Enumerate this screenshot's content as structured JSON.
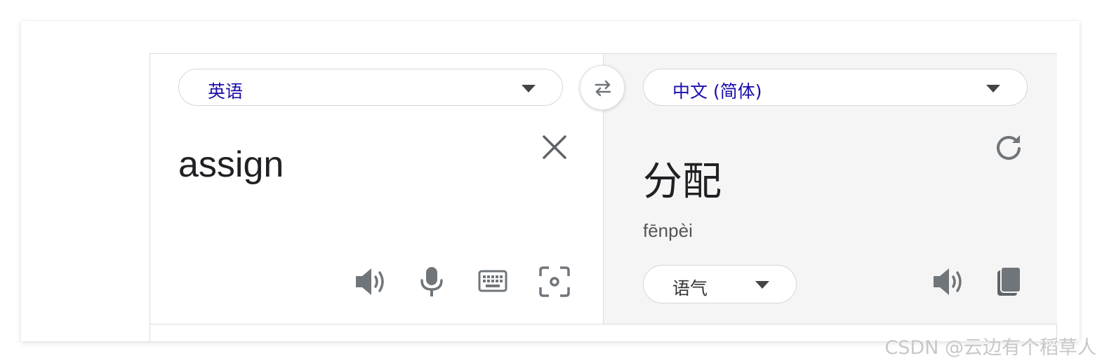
{
  "source": {
    "language": "英语",
    "text": "assign"
  },
  "target": {
    "language": "中文 (简体)",
    "text": "分配",
    "pinyin": "fēnpèi",
    "tone": "语气"
  },
  "icons": {
    "swap": "swap-arrows-icon",
    "clear": "close-icon",
    "refresh": "refresh-icon",
    "speaker": "speaker-icon",
    "mic": "microphone-icon",
    "keyboard": "keyboard-icon",
    "camera": "camera-scan-icon",
    "copy": "copy-icon"
  },
  "colors": {
    "language_label": "#1a0dab",
    "icon": "#70757a"
  },
  "watermark": "CSDN @云边有个稻草人"
}
